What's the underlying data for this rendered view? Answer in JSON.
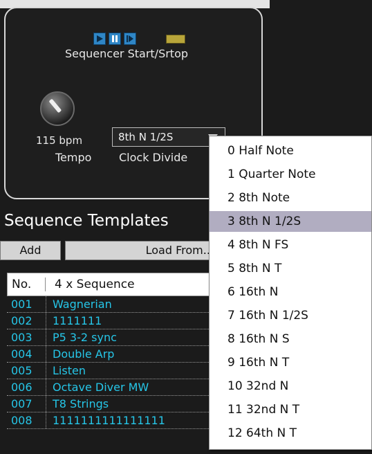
{
  "sequencer": {
    "label": "Sequencer Start/Srtop",
    "icons": [
      "play-icon",
      "pause-icon",
      "step-icon",
      "status-led"
    ]
  },
  "tempo": {
    "value": "115 bpm",
    "label": "Tempo"
  },
  "clock_divide": {
    "selected": "8th N 1/2S",
    "label": "Clock Divide"
  },
  "templates": {
    "title": "Sequence Templates",
    "add_label": "Add",
    "load_label": "Load From...",
    "columns": [
      "No.",
      "4 x Sequence"
    ],
    "rows": [
      {
        "no": "001",
        "name": "Wagnerian"
      },
      {
        "no": "002",
        "name": "1111111"
      },
      {
        "no": "003",
        "name": "P5 3-2 sync"
      },
      {
        "no": "004",
        "name": "Double Arp"
      },
      {
        "no": "005",
        "name": "Listen"
      },
      {
        "no": "006",
        "name": "Octave Diver MW"
      },
      {
        "no": "007",
        "name": "T8 Strings"
      },
      {
        "no": "008",
        "name": "1111111111111111"
      }
    ]
  },
  "dropdown": {
    "selected_index": 3,
    "options": [
      "0  Half Note",
      "1  Quarter Note",
      "2  8th Note",
      "3  8th N 1/2S",
      "4  8th N FS",
      "5  8th N T",
      "6  16th N",
      "7  16th N 1/2S",
      "8  16th N S",
      "9  16th N T",
      "10  32nd N",
      "11  32nd N T",
      "12  64th N T"
    ]
  },
  "colors": {
    "list_text": "#26c6e8",
    "selection": "#b1adc1",
    "transport_button": "#2f86c6",
    "led": "#b8a53a"
  }
}
